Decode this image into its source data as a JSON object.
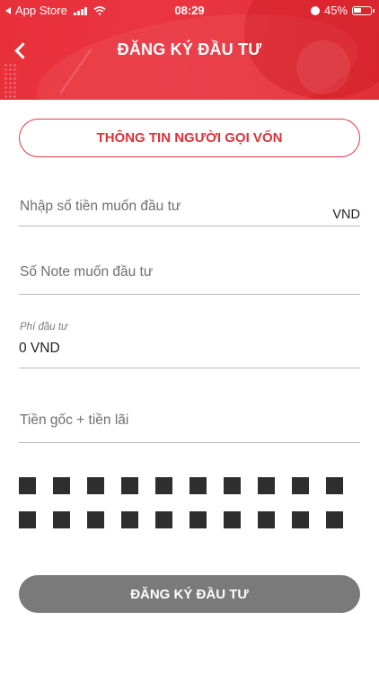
{
  "status_bar": {
    "carrier": "App Store",
    "time": "08:29",
    "battery": "45%",
    "battery_level": 0.45
  },
  "nav": {
    "title": "ĐĂNG KÝ ĐẦU TƯ",
    "back_icon": "chevron-left-icon"
  },
  "form": {
    "lender_info_button": "THÔNG TIN NGƯỜI GỌI VỐN",
    "amount_placeholder": "Nhập số tiền muốn đầu tư",
    "amount_unit": "VND",
    "note_placeholder": "Số Note muốn đầu tư",
    "fee_label": "Phí đầu tư",
    "fee_value": "0 VND",
    "total_placeholder": "Tiền gốc + tiền lãi",
    "submit_button": "ĐĂNG KÝ ĐẦU TƯ"
  },
  "colors": {
    "header_red": "#e8303a",
    "outline_red": "#e23a3f",
    "submit_disabled": "#7a7a7a"
  }
}
